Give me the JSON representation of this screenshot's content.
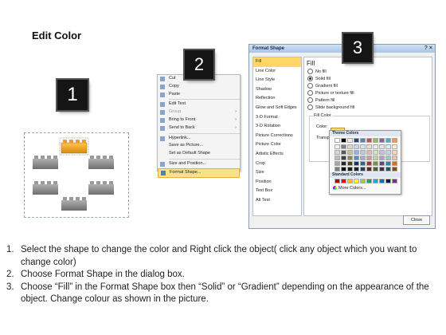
{
  "title": "Edit Color",
  "badges": [
    "1",
    "2",
    "3"
  ],
  "colors": {
    "accent": "#f0a020",
    "brick_gray": "#8d8d8d",
    "badge_bg": "#151515",
    "highlight": "#ffd766"
  },
  "context_menu": {
    "items": [
      {
        "label": "Cut",
        "icon": "scissors-icon",
        "disabled": false
      },
      {
        "label": "Copy",
        "icon": "copy-icon",
        "disabled": false
      },
      {
        "label": "Paste",
        "icon": "paste-icon",
        "disabled": false
      },
      {
        "label": "Edit Text",
        "icon": "edit-text-icon",
        "disabled": false
      },
      {
        "label": "Group",
        "icon": "group-icon",
        "disabled": true,
        "submenu": true
      },
      {
        "label": "Bring to Front",
        "icon": "bring-front-icon",
        "disabled": false,
        "submenu": true
      },
      {
        "label": "Send to Back",
        "icon": "send-back-icon",
        "disabled": false,
        "submenu": true
      },
      {
        "label": "Hyperlink...",
        "icon": "hyperlink-icon",
        "disabled": false
      },
      {
        "label": "Save as Picture...",
        "icon": "",
        "disabled": false
      },
      {
        "label": "Set as Default Shape",
        "icon": "",
        "disabled": false
      },
      {
        "label": "Size and Position...",
        "icon": "size-icon",
        "disabled": false
      },
      {
        "label": "Format Shape...",
        "icon": "format-shape-icon",
        "disabled": false,
        "highlighted": true
      }
    ]
  },
  "dialog": {
    "title": "Format Shape",
    "close_glyph": "? ×",
    "categories": [
      "Fill",
      "Line Color",
      "Line Style",
      "Shadow",
      "Reflection",
      "Glow and Soft Edges",
      "3-D Format",
      "3-D Rotation",
      "Picture Corrections",
      "Picture Color",
      "Artistic Effects",
      "Crop",
      "Size",
      "Position",
      "Text Box",
      "Alt Text"
    ],
    "selected_category": "Fill",
    "fill_heading": "Fill",
    "options": [
      {
        "label": "No fill",
        "checked": false
      },
      {
        "label": "Solid fill",
        "checked": true
      },
      {
        "label": "Gradient fill",
        "checked": false
      },
      {
        "label": "Picture or texture fill",
        "checked": false
      },
      {
        "label": "Pattern fill",
        "checked": false
      },
      {
        "label": "Slide background fill",
        "checked": false
      }
    ],
    "fill_color_label": "Fill Color",
    "color_label": "Color:",
    "transparency_label": "Transpa",
    "close_button": "Close"
  },
  "color_dropdown": {
    "theme_header": "Theme Colors",
    "standard_header": "Standard Colors",
    "more_colors": "More Colors...",
    "theme_top": [
      "#ffffff",
      "#000000",
      "#eeece1",
      "#1f497d",
      "#4f81bd",
      "#c0504d",
      "#9bbb59",
      "#8064a2",
      "#4bacc6",
      "#f79646"
    ],
    "theme_rows": [
      [
        "#f2f2f2",
        "#7f7f7f",
        "#ddd9c3",
        "#c6d9f0",
        "#dbe5f1",
        "#f2dcdb",
        "#ebf1dd",
        "#e5e0ec",
        "#dbeef3",
        "#fdeada"
      ],
      [
        "#d8d8d8",
        "#595959",
        "#c4bd97",
        "#8db3e2",
        "#b8cce4",
        "#e5b9b7",
        "#d7e3bc",
        "#ccc1d9",
        "#b7dde8",
        "#fbd5b5"
      ],
      [
        "#bfbfbf",
        "#3f3f3f",
        "#938953",
        "#548dd4",
        "#95b3d7",
        "#d99694",
        "#c3d69b",
        "#b2a2c7",
        "#92cddc",
        "#fac08f"
      ],
      [
        "#a5a5a5",
        "#262626",
        "#494429",
        "#17365d",
        "#366092",
        "#953734",
        "#76923c",
        "#5f497a",
        "#31859b",
        "#e36c09"
      ],
      [
        "#7f7f7f",
        "#0c0c0c",
        "#1d1b10",
        "#0f243e",
        "#244061",
        "#632423",
        "#4f6128",
        "#3f3151",
        "#205867",
        "#974806"
      ]
    ],
    "standard": [
      "#c00000",
      "#ff0000",
      "#ffc000",
      "#ffff00",
      "#92d050",
      "#00b050",
      "#00b0f0",
      "#0070c0",
      "#002060",
      "#7030a0"
    ]
  },
  "steps": [
    {
      "num": "1.",
      "text": "Select the shape to change the color and Right click the object( click any object which you want to change color)"
    },
    {
      "num": "2.",
      "text": "Choose Format Shape in the dialog box."
    },
    {
      "num": "3.",
      "text": "Choose “Fill” in the Format Shape box then “Solid” or “Gradient” depending on the appearance of the object. Change colour as shown in the picture."
    }
  ]
}
